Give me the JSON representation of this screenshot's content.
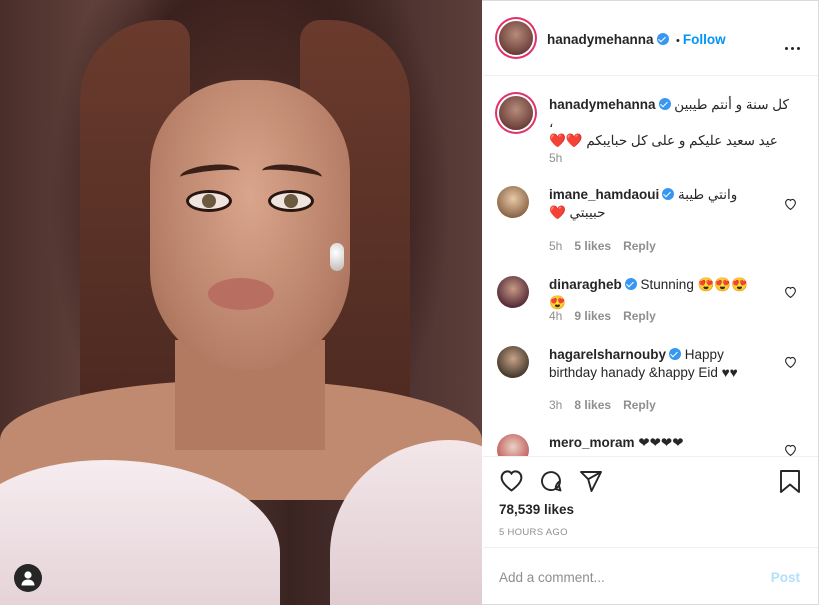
{
  "post": {
    "username": "hanadymehanna",
    "follow_label": "Follow",
    "dot": "•",
    "caption_line1": "كل سنة و أنتم طيبين ،",
    "caption_line2": "عيد سعيد عليكم و على كل حبايبكم ❤️❤️",
    "caption_time": "5h",
    "likes": "78,539 likes",
    "posted": "5 HOURS AGO",
    "add_comment_placeholder": "Add a comment...",
    "post_label": "Post"
  },
  "comments": [
    {
      "username": "imane_hamdaoui",
      "text": "وانتي طيبة حبيبتي ❤️",
      "time": "5h",
      "likes": "5 likes",
      "reply": "Reply"
    },
    {
      "username": "dinaragheb",
      "text": "Stunning 😍😍😍😍",
      "time": "4h",
      "likes": "9 likes",
      "reply": "Reply"
    },
    {
      "username": "hagarelsharnouby",
      "text": "Happy birthday hanady &happy Eid ♥♥",
      "time": "3h",
      "likes": "8 likes",
      "reply": "Reply"
    },
    {
      "username": "mero_moram",
      "text": "❤❤❤❤",
      "time": "",
      "likes": "",
      "reply": ""
    }
  ],
  "colors": {
    "accent": "#0095f6",
    "verified": "#3897f0",
    "muted": "#8e8e8e"
  }
}
